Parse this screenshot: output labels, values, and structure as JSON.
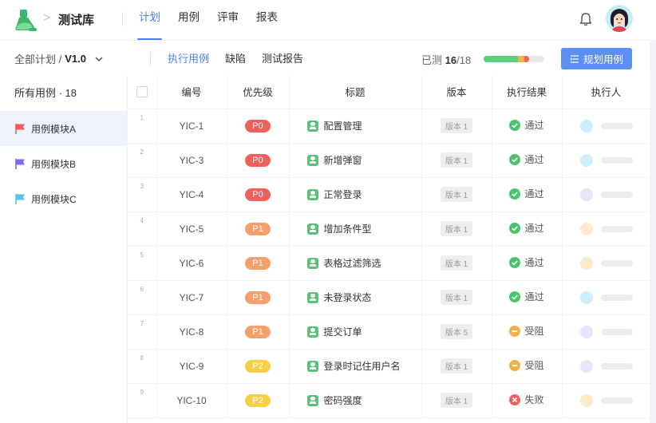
{
  "header": {
    "app_name": "测试库",
    "breadcrumb_sep": ">",
    "nav": [
      {
        "label": "计划",
        "active": true
      },
      {
        "label": "用例",
        "active": false
      },
      {
        "label": "评审",
        "active": false
      },
      {
        "label": "报表",
        "active": false
      }
    ]
  },
  "subbar": {
    "plan_label": "全部计划 /",
    "version": "V1.0",
    "tabs": [
      {
        "label": "执行用例",
        "active": true
      },
      {
        "label": "缺陷",
        "active": false
      },
      {
        "label": "测试报告",
        "active": false
      }
    ],
    "progress_prefix": "已测",
    "progress_done": "16",
    "progress_total": "/18",
    "progress_fraction": 0.889,
    "plan_button": "规划用例"
  },
  "sidebar": {
    "title": "所有用例 · 18",
    "modules": [
      {
        "label": "用例模块A",
        "color": "#f25b5b",
        "active": true
      },
      {
        "label": "用例模块B",
        "color": "#7b6df0",
        "active": false
      },
      {
        "label": "用例模块C",
        "color": "#5cc0e8",
        "active": false
      }
    ]
  },
  "table": {
    "headers": [
      "编号",
      "优先级",
      "标题",
      "版本",
      "执行结果",
      "执行人"
    ],
    "rows": [
      {
        "idx": "1",
        "id": "YIC-1",
        "priority": "P0",
        "title": "配置管理",
        "version": "版本 1",
        "result": "通过",
        "exec_color": "#cdeefc"
      },
      {
        "idx": "2",
        "id": "YIC-3",
        "priority": "P0",
        "title": "新增弹窗",
        "version": "版本 1",
        "result": "通过",
        "exec_color": "#cdeefc"
      },
      {
        "idx": "3",
        "id": "YIC-4",
        "priority": "P0",
        "title": "正常登录",
        "version": "版本 1",
        "result": "通过",
        "exec_color": "#ece2fc"
      },
      {
        "idx": "4",
        "id": "YIC-5",
        "priority": "P1",
        "title": "增加条件型",
        "version": "版本 1",
        "result": "通过",
        "exec_color": "#fde9cc"
      },
      {
        "idx": "5",
        "id": "YIC-6",
        "priority": "P1",
        "title": "表格过滤筛选",
        "version": "版本 1",
        "result": "通过",
        "exec_color": "#fde9cc"
      },
      {
        "idx": "6",
        "id": "YIC-7",
        "priority": "P1",
        "title": "未登录状态",
        "version": "版本 1",
        "result": "通过",
        "exec_color": "#cdeefc"
      },
      {
        "idx": "7",
        "id": "YIC-8",
        "priority": "P1",
        "title": "提交订单",
        "version": "版本 5",
        "result": "受阻",
        "exec_color": "#ece2fc"
      },
      {
        "idx": "8",
        "id": "YIC-9",
        "priority": "P2",
        "title": "登录时记住用户名",
        "version": "版本 1",
        "result": "受阻",
        "exec_color": "#ece2fc"
      },
      {
        "idx": "9",
        "id": "YIC-10",
        "priority": "P2",
        "title": "密码强度",
        "version": "版本 1",
        "result": "失败",
        "exec_color": "#fde9cc"
      }
    ]
  },
  "colors": {
    "accent": "#4a80f0",
    "button": "#5b8ff4",
    "p0": "#f0605d",
    "p1": "#f5a06a",
    "p2": "#f7cf44",
    "pass": "#4cc46e",
    "blocked": "#f5b049",
    "fail": "#f0605d"
  }
}
